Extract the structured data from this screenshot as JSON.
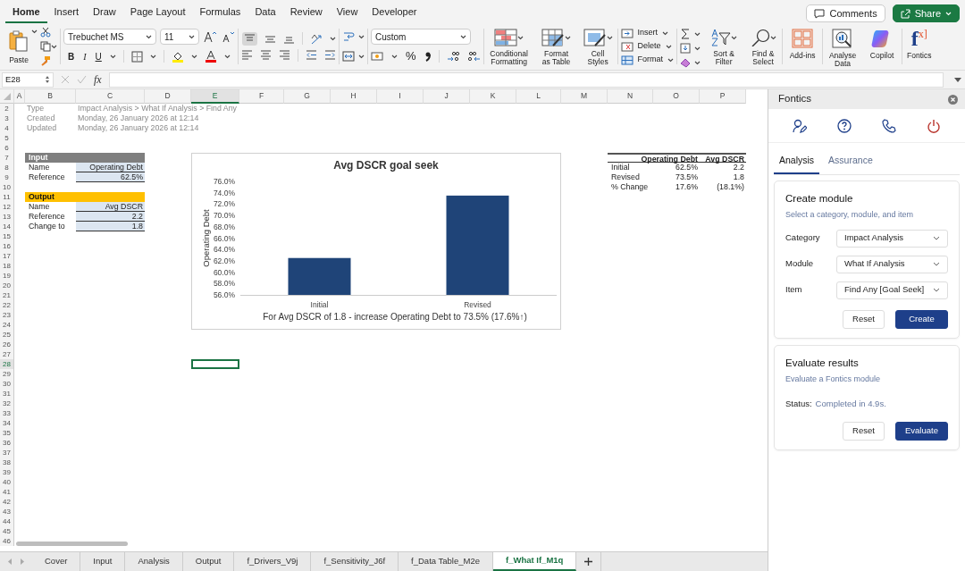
{
  "ribbon": {
    "tabs": [
      {
        "label": "Home",
        "selected": true
      },
      {
        "label": "Insert",
        "selected": false
      },
      {
        "label": "Draw",
        "selected": false
      },
      {
        "label": "Page Layout",
        "selected": false
      },
      {
        "label": "Formulas",
        "selected": false
      },
      {
        "label": "Data",
        "selected": false
      },
      {
        "label": "Review",
        "selected": false
      },
      {
        "label": "View",
        "selected": false
      },
      {
        "label": "Developer",
        "selected": false
      }
    ],
    "comments_button": "Comments",
    "share_button": "Share",
    "paste_label": "Paste",
    "font_name": "Trebuchet MS",
    "font_size": "11",
    "style_buttons": [
      "B",
      "I",
      "U"
    ],
    "number_format": "Custom",
    "percent_button": "%",
    "style_large_buttons": [
      "Conditional Formatting",
      "Format as Table",
      "Cell Styles"
    ],
    "cell_buttons": [
      "Insert",
      "Delete",
      "Format"
    ],
    "editing_buttons": [
      "Sort & Filter",
      "Find & Select"
    ],
    "addin_buttons": [
      "Add-ins",
      "Analyse Data",
      "Copilot"
    ],
    "fontics_button": {
      "logo_main": "f",
      "logo_sup": "x]",
      "label": "Fontics"
    }
  },
  "formula_bar": {
    "name_box": "E28",
    "function_label": "fx"
  },
  "sheet": {
    "columns": [
      {
        "label": "A",
        "selected": false
      },
      {
        "label": "B",
        "selected": false
      },
      {
        "label": "C",
        "selected": false
      },
      {
        "label": "D",
        "selected": false
      },
      {
        "label": "E",
        "selected": true
      },
      {
        "label": "F",
        "selected": false
      },
      {
        "label": "G",
        "selected": false
      },
      {
        "label": "H",
        "selected": false
      },
      {
        "label": "I",
        "selected": false
      },
      {
        "label": "J",
        "selected": false
      },
      {
        "label": "K",
        "selected": false
      },
      {
        "label": "L",
        "selected": false
      },
      {
        "label": "M",
        "selected": false
      },
      {
        "label": "N",
        "selected": false
      },
      {
        "label": "O",
        "selected": false
      },
      {
        "label": "P",
        "selected": false
      }
    ],
    "rows": [
      {
        "label": "2",
        "selected": false
      },
      {
        "label": "3",
        "selected": false
      },
      {
        "label": "4",
        "selected": false
      },
      {
        "label": "5",
        "selected": false
      },
      {
        "label": "6",
        "selected": false
      },
      {
        "label": "7",
        "selected": false
      },
      {
        "label": "8",
        "selected": false
      },
      {
        "label": "9",
        "selected": false
      },
      {
        "label": "10",
        "selected": false
      },
      {
        "label": "11",
        "selected": false
      },
      {
        "label": "12",
        "selected": false
      },
      {
        "label": "13",
        "selected": false
      },
      {
        "label": "14",
        "selected": false
      },
      {
        "label": "15",
        "selected": false
      },
      {
        "label": "16",
        "selected": false
      },
      {
        "label": "17",
        "selected": false
      },
      {
        "label": "18",
        "selected": false
      },
      {
        "label": "19",
        "selected": false
      },
      {
        "label": "20",
        "selected": false
      },
      {
        "label": "21",
        "selected": false
      },
      {
        "label": "22",
        "selected": false
      },
      {
        "label": "23",
        "selected": false
      },
      {
        "label": "24",
        "selected": false
      },
      {
        "label": "25",
        "selected": false
      },
      {
        "label": "26",
        "selected": false
      },
      {
        "label": "27",
        "selected": false
      },
      {
        "label": "28",
        "selected": true
      },
      {
        "label": "29",
        "selected": false
      },
      {
        "label": "30",
        "selected": false
      },
      {
        "label": "31",
        "selected": false
      },
      {
        "label": "32",
        "selected": false
      },
      {
        "label": "33",
        "selected": false
      },
      {
        "label": "34",
        "selected": false
      },
      {
        "label": "35",
        "selected": false
      },
      {
        "label": "36",
        "selected": false
      },
      {
        "label": "37",
        "selected": false
      },
      {
        "label": "38",
        "selected": false
      },
      {
        "label": "39",
        "selected": false
      },
      {
        "label": "40",
        "selected": false
      },
      {
        "label": "41",
        "selected": false
      },
      {
        "label": "42",
        "selected": false
      },
      {
        "label": "43",
        "selected": false
      },
      {
        "label": "44",
        "selected": false
      },
      {
        "label": "45",
        "selected": false
      },
      {
        "label": "46",
        "selected": false
      }
    ],
    "info": [
      {
        "label": "Type",
        "value": "Impact Analysis > What If Analysis > Find Any"
      },
      {
        "label": "Created",
        "value": "Monday, 26 January 2026 at 12:14"
      },
      {
        "label": "Updated",
        "value": "Monday, 26 January 2026 at 12:14"
      }
    ],
    "input_table": {
      "header": "Input",
      "rows": [
        {
          "label": "Name",
          "value": "Operating Debt"
        },
        {
          "label": "Reference",
          "value": "62.5%"
        }
      ]
    },
    "output_table": {
      "header": "Output",
      "rows": [
        {
          "label": "Name",
          "value": "Avg DSCR"
        },
        {
          "label": "Reference",
          "value": "2.2"
        },
        {
          "label": "Change to",
          "value": "1.8"
        }
      ]
    },
    "results_table": {
      "columns": [
        "Operating Debt",
        "Avg DSCR"
      ],
      "rows": [
        {
          "label": "Initial",
          "values": [
            "62.5%",
            "2.2"
          ]
        },
        {
          "label": "Revised",
          "values": [
            "73.5%",
            "1.8"
          ]
        },
        {
          "label": "% Change",
          "values": [
            "17.6%",
            "(18.1%)"
          ]
        }
      ]
    },
    "chart": {
      "caption": "For Avg DSCR of 1.8 - increase Operating Debt to 73.5% (17.6%↑)",
      "chart_data": {
        "type": "bar",
        "title": "Avg DSCR goal seek",
        "ylabel": "Operating Debt",
        "categories": [
          "Initial",
          "Revised"
        ],
        "series": [
          {
            "color": "#1f4478",
            "values": [
              0.625,
              0.735
            ]
          }
        ],
        "ylim": [
          0.56,
          0.76
        ],
        "yticks": [
          {
            "value": 0.56,
            "label": "56.0%"
          },
          {
            "value": 0.58,
            "label": "58.0%"
          },
          {
            "value": 0.6,
            "label": "60.0%"
          },
          {
            "value": 0.62,
            "label": "62.0%"
          },
          {
            "value": 0.64,
            "label": "64.0%"
          },
          {
            "value": 0.66,
            "label": "66.0%"
          },
          {
            "value": 0.68,
            "label": "68.0%"
          },
          {
            "value": 0.7,
            "label": "70.0%"
          },
          {
            "value": 0.72,
            "label": "72.0%"
          },
          {
            "value": 0.74,
            "label": "74.0%"
          },
          {
            "value": 0.76,
            "label": "76.0%"
          }
        ]
      }
    }
  },
  "sheet_tabs": [
    {
      "label": "Cover",
      "selected": false
    },
    {
      "label": "Input",
      "selected": false
    },
    {
      "label": "Analysis",
      "selected": false
    },
    {
      "label": "Output",
      "selected": false
    },
    {
      "label": "f_Drivers_V9j",
      "selected": false
    },
    {
      "label": "f_Sensitivity_J6f",
      "selected": false
    },
    {
      "label": "f_Data Table_M2e",
      "selected": false
    },
    {
      "label": "f_What If_M1q",
      "selected": true
    }
  ],
  "panel": {
    "title": "Fontics",
    "tabs": [
      {
        "label": "Analysis",
        "selected": true
      },
      {
        "label": "Assurance",
        "selected": false
      }
    ],
    "create_card": {
      "title": "Create module",
      "subtitle": "Select a category, module, and item",
      "fields": [
        {
          "label": "Category",
          "value": "Impact Analysis"
        },
        {
          "label": "Module",
          "value": "What If Analysis"
        },
        {
          "label": "Item",
          "value": "Find Any [Goal Seek]"
        }
      ],
      "buttons": [
        {
          "label": "Reset",
          "kind": "secondary"
        },
        {
          "label": "Create",
          "kind": "primary"
        }
      ]
    },
    "evaluate_card": {
      "title": "Evaluate results",
      "subtitle": "Evaluate a Fontics module",
      "status_label": "Status:",
      "status_value": "Completed in 4.9s.",
      "buttons": [
        {
          "label": "Reset",
          "kind": "secondary"
        },
        {
          "label": "Evaluate",
          "kind": "primary"
        }
      ]
    }
  }
}
